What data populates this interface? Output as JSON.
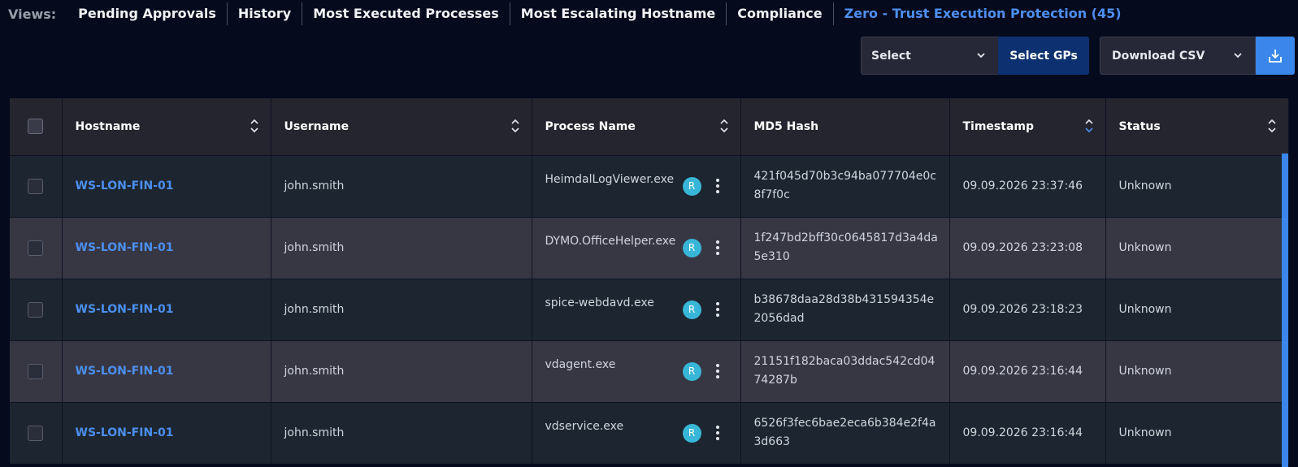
{
  "views": {
    "label": "Views:",
    "tabs": [
      {
        "label": "Pending Approvals",
        "active": false
      },
      {
        "label": "History",
        "active": false
      },
      {
        "label": "Most Executed Processes",
        "active": false
      },
      {
        "label": "Most Escalating Hostname",
        "active": false
      },
      {
        "label": "Compliance",
        "active": false
      },
      {
        "label": "Zero - Trust Execution Protection (45)",
        "active": true
      }
    ]
  },
  "toolbar": {
    "select_label": "Select",
    "select_gps_label": "Select GPs",
    "download_label": "Download CSV"
  },
  "table": {
    "columns": {
      "hostname": "Hostname",
      "username": "Username",
      "process": "Process Name",
      "md5": "MD5 Hash",
      "timestamp": "Timestamp",
      "status": "Status"
    },
    "badge": "R",
    "rows": [
      {
        "hostname": "WS-LON-FIN-01",
        "username": "john.smith",
        "process": "HeimdalLogViewer.exe",
        "md5": "421f045d70b3c94ba077704e0c8f7f0c",
        "timestamp": "09.09.2026  23:37:46",
        "status": "Unknown"
      },
      {
        "hostname": "WS-LON-FIN-01",
        "username": "john.smith",
        "process": "DYMO.OfficeHelper.exe",
        "md5": "1f247bd2bff30c0645817d3a4da5e310",
        "timestamp": "09.09.2026  23:23:08",
        "status": "Unknown"
      },
      {
        "hostname": "WS-LON-FIN-01",
        "username": "john.smith",
        "process": "spice-webdavd.exe",
        "md5": "b38678daa28d38b431594354e2056dad",
        "timestamp": "09.09.2026  23:18:23",
        "status": "Unknown"
      },
      {
        "hostname": "WS-LON-FIN-01",
        "username": "john.smith",
        "process": "vdagent.exe",
        "md5": "21151f182baca03ddac542cd0474287b",
        "timestamp": "09.09.2026  23:16:44",
        "status": "Unknown"
      },
      {
        "hostname": "WS-LON-FIN-01",
        "username": "john.smith",
        "process": "vdservice.exe",
        "md5": "6526f3fec6bae2eca6b384e2f4a3d663",
        "timestamp": "09.09.2026  23:16:44",
        "status": "Unknown"
      }
    ]
  },
  "colors": {
    "accent": "#4b8fef",
    "background": "#050a1c",
    "badge": "#38b6d8"
  },
  "icons": {
    "select_chevron": "chevron-down-icon",
    "download": "download-icon",
    "sort": "sort-icon",
    "kebab": "kebab-menu-icon"
  }
}
